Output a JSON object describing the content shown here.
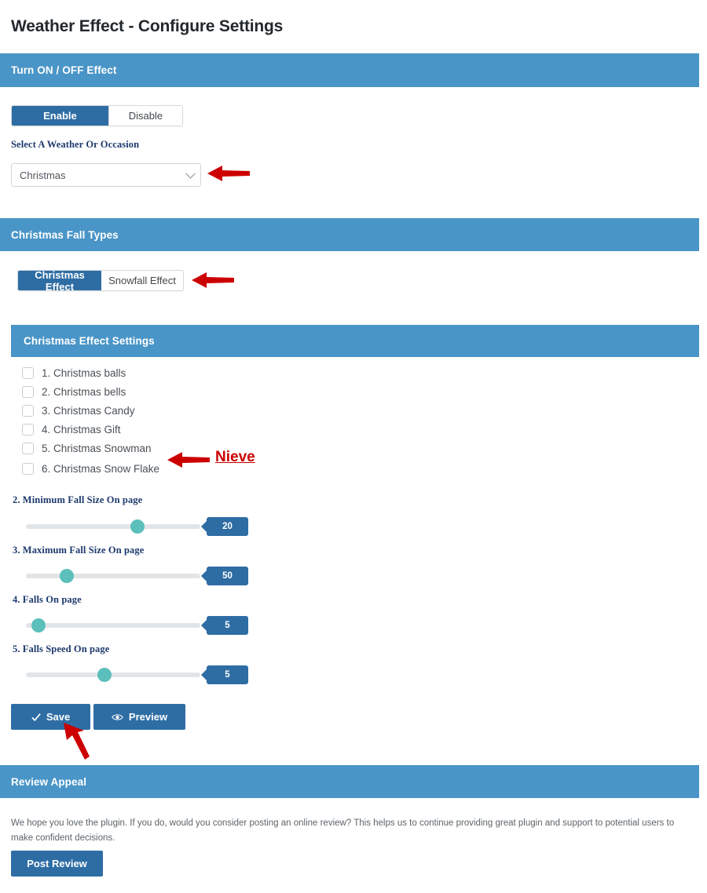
{
  "page": {
    "title": "Weather Effect - Configure Settings"
  },
  "colors": {
    "panel_header": "#4a95c7",
    "primary_button": "#2e6da4",
    "slider_handle": "#5bbfbb",
    "slider_track": "#e2e5e7",
    "annotation_red": "#cc0000",
    "serif_label": "#1e3a6e"
  },
  "sections": {
    "toggle": {
      "header": "Turn ON / OFF Effect",
      "enable_label": "Enable",
      "disable_label": "Disable",
      "active": "Enable",
      "select_label": "Select A Weather Or Occasion",
      "select_value": "Christmas",
      "select_options": [
        "Christmas"
      ]
    },
    "fall_types": {
      "header": "Christmas Fall Types",
      "tabs": [
        {
          "label": "Christmas Effect",
          "active": true
        },
        {
          "label": "Snowfall Effect",
          "active": false
        }
      ]
    },
    "effect_settings": {
      "header": "Christmas Effect Settings",
      "checkboxes": [
        {
          "label": "1. Christmas balls",
          "checked": false
        },
        {
          "label": "2. Christmas bells",
          "checked": false
        },
        {
          "label": "3. Christmas Candy",
          "checked": false
        },
        {
          "label": "4. Christmas Gift",
          "checked": false
        },
        {
          "label": "5. Christmas Snowman",
          "checked": false
        },
        {
          "label": "6. Christmas Snow Flake",
          "checked": false
        }
      ],
      "sliders": [
        {
          "label": "2. Minimum Fall Size On page",
          "value": "20",
          "percent": 64
        },
        {
          "label": "3. Maximum Fall Size On page",
          "value": "50",
          "percent": 22
        },
        {
          "label": "4. Falls On page",
          "value": "5",
          "percent": 7
        },
        {
          "label": "5. Falls Speed On page",
          "value": "5",
          "percent": 43
        }
      ],
      "save_label": "Save",
      "preview_label": "Preview"
    },
    "review": {
      "header": "Review Appeal",
      "body": "We hope you love the plugin. If you do, would you consider posting an online review? This helps us to continue providing great plugin and support to potential users to make confident decisions.",
      "post_label": "Post Review"
    }
  },
  "annotations": {
    "note_nieve": "Nieve"
  }
}
